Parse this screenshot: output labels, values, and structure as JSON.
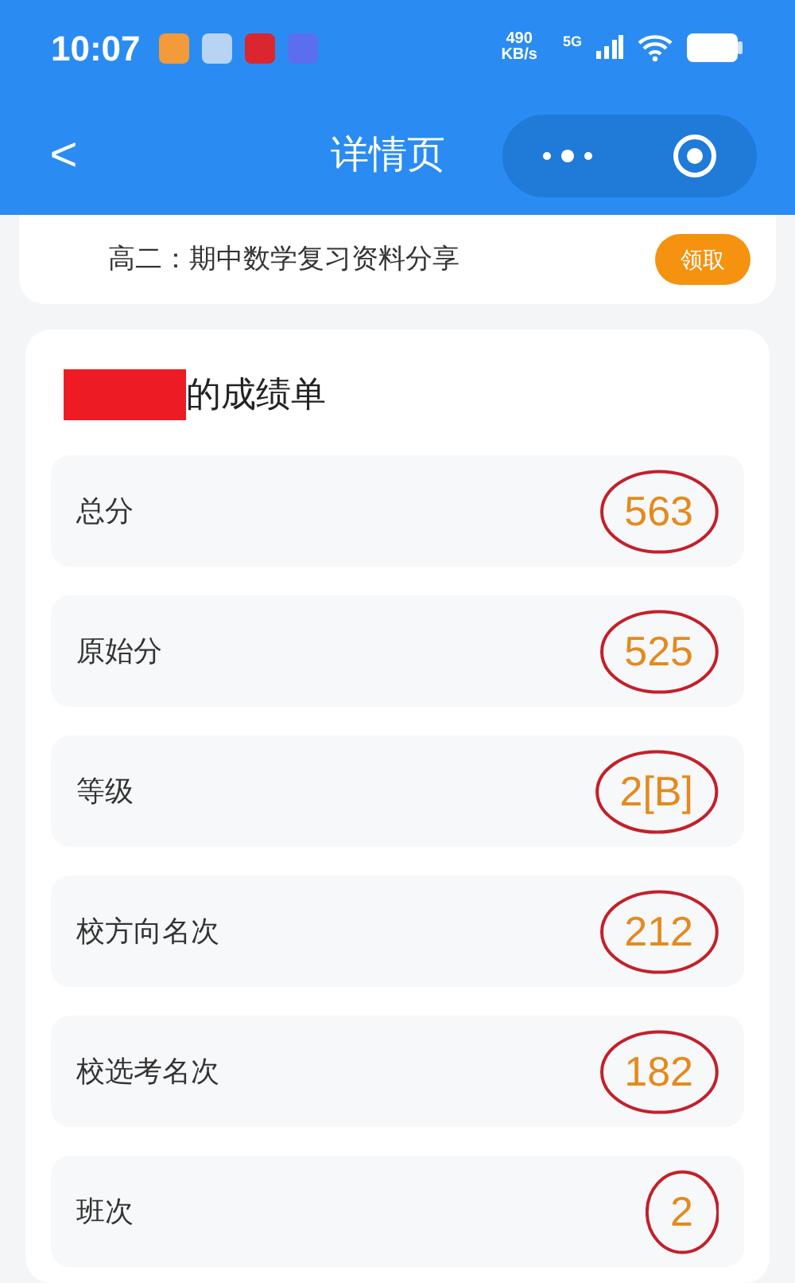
{
  "status_bar": {
    "time": "10:07",
    "speed_value": "490",
    "speed_unit": "KB/s",
    "network": "5G"
  },
  "header": {
    "back": "<",
    "title": "详情页"
  },
  "banner": {
    "text": "高二：期中数学复习资料分享",
    "button": "领取"
  },
  "report": {
    "title": "的成绩单",
    "rows": [
      {
        "label": "总分",
        "value": "563",
        "circled": true
      },
      {
        "label": "原始分",
        "value": "525",
        "circled": true
      },
      {
        "label": "等级",
        "value": "2[B]",
        "circled": true
      },
      {
        "label": "校方向名次",
        "value": "212",
        "circled": true
      },
      {
        "label": "校选考名次",
        "value": "182",
        "circled": true
      },
      {
        "label": "班次",
        "value": "2",
        "circled": true
      }
    ]
  }
}
